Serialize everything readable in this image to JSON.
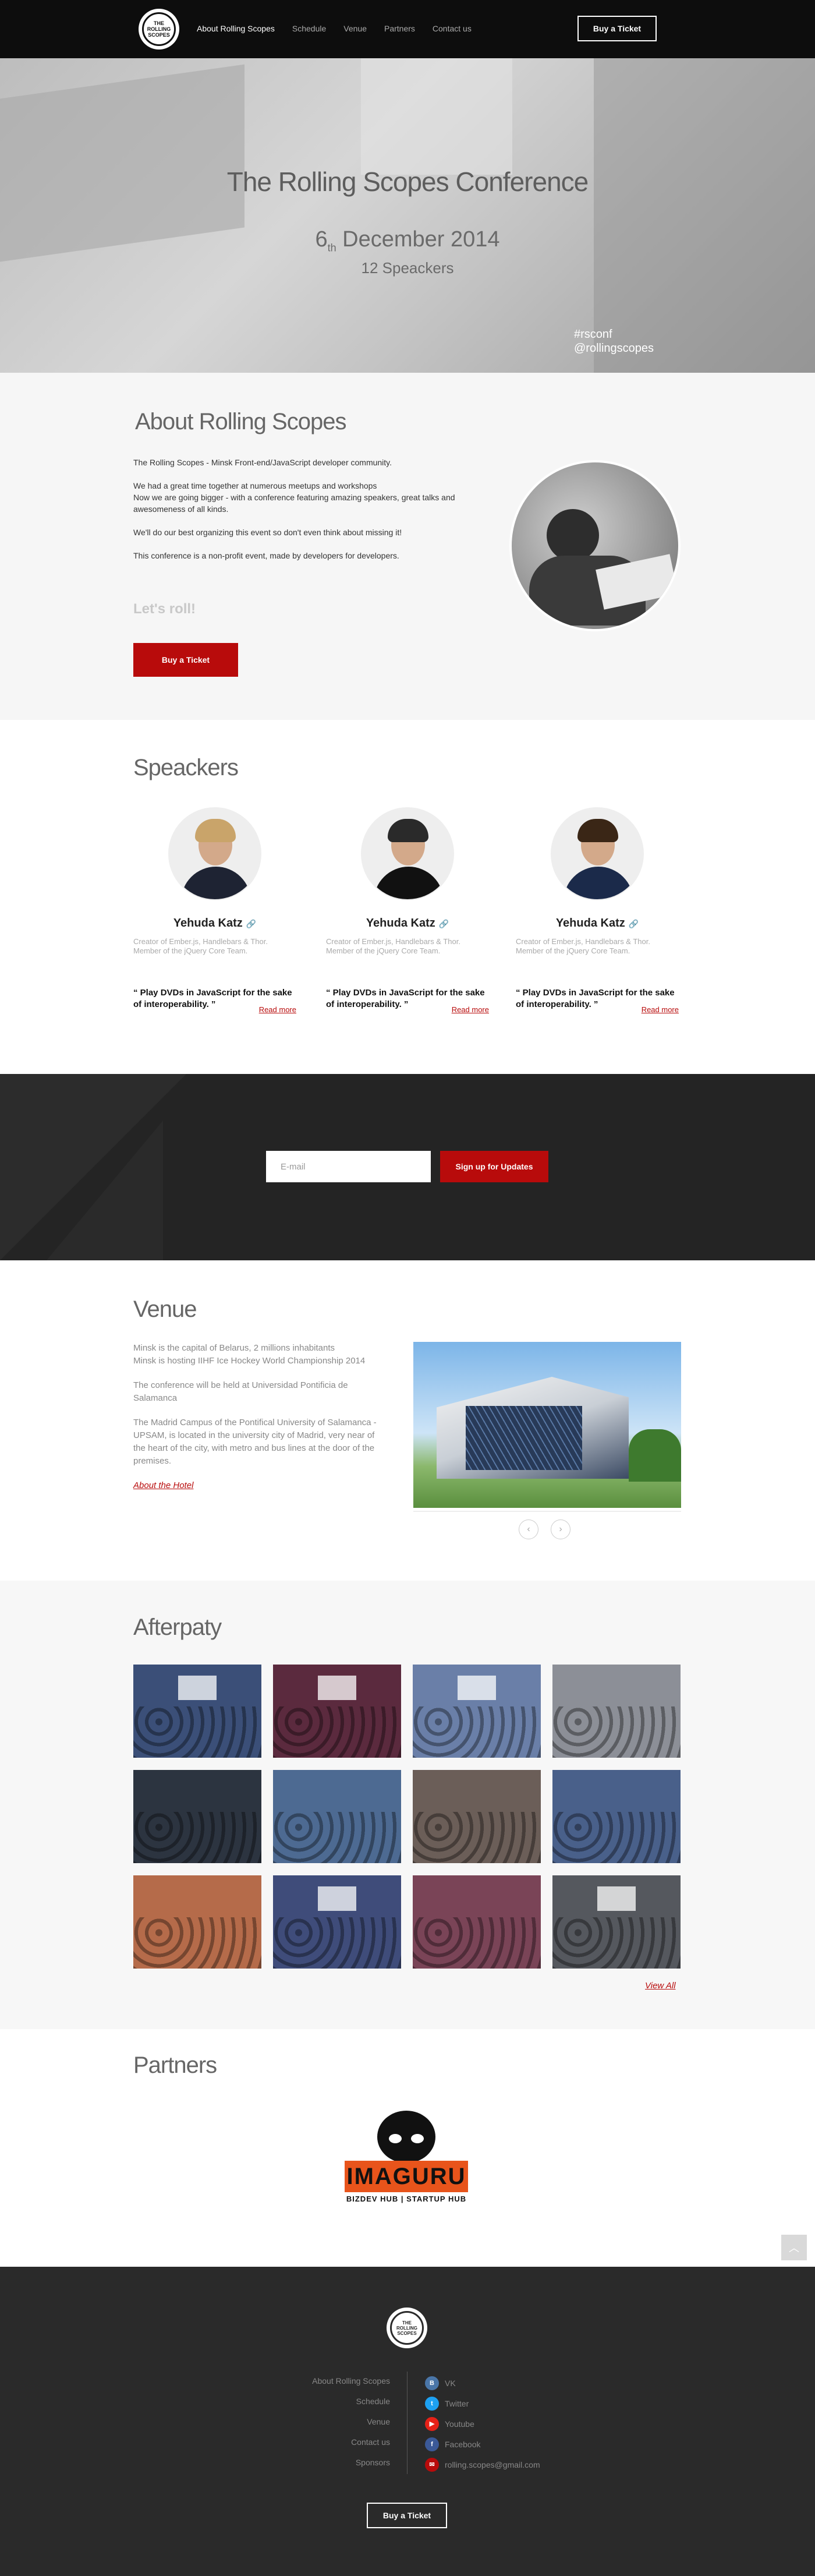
{
  "colors": {
    "accent": "#b80b0b",
    "header_bg": "#0d0d0d",
    "footer_bg": "#2a2a2a",
    "partner_orange": "#e8541b"
  },
  "header": {
    "logo_text": "THE ROLLING SCOPES",
    "nav": [
      "About Rolling Scopes",
      "Schedule",
      "Venue",
      "Partners",
      "Contact us"
    ],
    "cta": "Buy a Ticket"
  },
  "hero": {
    "title": "The Rolling Scopes Conference",
    "date_day": "6",
    "date_suffix": "th",
    "date_rest": "December 2014",
    "speakers_count": "12 Speackers",
    "tag1": "#rsconf",
    "tag2": "@rollingscopes"
  },
  "about": {
    "title": "About Rolling Scopes",
    "p1": "The Rolling Scopes - Minsk Front-end/JavaScript developer community.",
    "p2a": "We had a great time together at numerous meetups and workshops",
    "p2b": "Now we are going bigger - with a conference featuring amazing speakers, great talks and awesomeness of all kinds.",
    "p3": "We'll do our best organizing this event so don't even think about missing it!",
    "p4": "This conference is a non-profit event, made by developers for developers.",
    "roll": "Let's roll!",
    "cta": "Buy a Ticket"
  },
  "speakers": {
    "title": "Speackers",
    "items": [
      {
        "name": "Yehuda Katz",
        "role": "Creator of Ember.js, Handlebars & Thor. Member of the jQuery Core Team.",
        "quote": "“ Play DVDs in JavaScript for the sake of interoperability. ”",
        "more": "Read more"
      },
      {
        "name": "Yehuda Katz",
        "role": "Creator of Ember.js, Handlebars & Thor. Member of the jQuery Core Team.",
        "quote": "“ Play DVDs in JavaScript for the sake of interoperability. ”",
        "more": "Read more"
      },
      {
        "name": "Yehuda Katz",
        "role": "Creator of Ember.js, Handlebars & Thor. Member of the jQuery Core Team.",
        "quote": "“ Play DVDs in JavaScript for the sake of interoperability. ”",
        "more": "Read more"
      }
    ]
  },
  "subscribe": {
    "placeholder": "E-mail",
    "button": "Sign up for Updates"
  },
  "venue": {
    "title": "Venue",
    "p1a": "Minsk is the capital of Belarus, 2 millions inhabitants",
    "p1b": "Minsk is hosting IIHF Ice Hockey World Championship 2014",
    "p2": "The conference will be held at Universidad Pontificia de Salamanca",
    "p3": "The Madrid Campus of the Pontifical University of Salamanca - UPSAM, is located in the university city of Madrid, very near of the heart of the city, with metro and bus lines at the door of the premises.",
    "hotel": "About the Hotel",
    "prev_icon": "‹",
    "next_icon": "›"
  },
  "afterparty": {
    "title": "Afterpaty",
    "view_all": "View All"
  },
  "partners": {
    "title": "Partners",
    "logo_word": "IMAGURU",
    "logo_sub": "BIZDEV HUB | STARTUP HUB"
  },
  "footer": {
    "logo_text": "THE ROLLING SCOPES",
    "links": [
      "About Rolling Scopes",
      "Schedule",
      "Venue",
      "Contact us",
      "Sponsors"
    ],
    "social": [
      {
        "icon": "vk-icon",
        "glyph": "B",
        "color": "#4a76a8",
        "label": "VK"
      },
      {
        "icon": "twitter-icon",
        "glyph": "t",
        "color": "#1da1f2",
        "label": "Twitter"
      },
      {
        "icon": "youtube-icon",
        "glyph": "▶",
        "color": "#e62117",
        "label": "Youtube"
      },
      {
        "icon": "facebook-icon",
        "glyph": "f",
        "color": "#3b5998",
        "label": "Facebook"
      },
      {
        "icon": "email-icon",
        "glyph": "✉",
        "color": "#b80b0b",
        "label": "rolling.scopes@gmail.com"
      }
    ],
    "cta": "Buy a Ticket"
  }
}
